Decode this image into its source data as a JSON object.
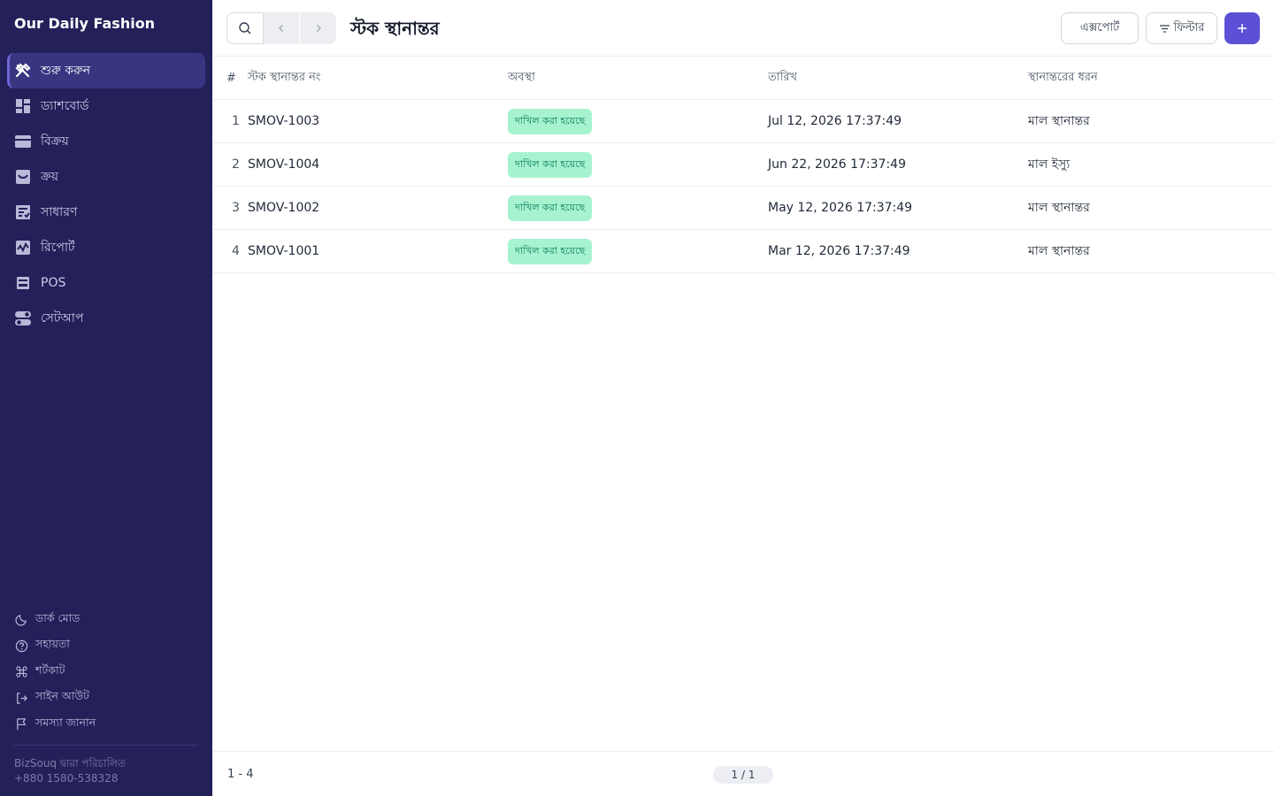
{
  "app": {
    "brand": "Our Daily Fashion"
  },
  "sidebar": {
    "items": [
      {
        "label": "শুরু করুন",
        "icon": "tools-icon",
        "active": true
      },
      {
        "label": "ড্যাশবোর্ড",
        "icon": "dashboard-icon"
      },
      {
        "label": "বিক্রয়",
        "icon": "card-icon"
      },
      {
        "label": "ক্রয়",
        "icon": "inbox-icon"
      },
      {
        "label": "সাধারণ",
        "icon": "ledger-icon"
      },
      {
        "label": "রিপোর্ট",
        "icon": "chart-icon"
      },
      {
        "label": "POS",
        "icon": "pos-icon"
      },
      {
        "label": "সেটআপ",
        "icon": "toggle-icon"
      }
    ],
    "bottom": [
      {
        "label": "ডার্ক মোড",
        "icon": "moon-icon"
      },
      {
        "label": "সহায়তা",
        "icon": "help-icon"
      },
      {
        "label": "শর্টকাট",
        "icon": "command-icon"
      },
      {
        "label": "সাইন আউট",
        "icon": "logout-icon"
      },
      {
        "label": "সমস্যা জানান",
        "icon": "flag-icon"
      }
    ],
    "powered_by": "BizSouq দ্বারা পরিচালিত",
    "phone": "+880 1580-538328"
  },
  "header": {
    "title": "স্টক স্থানান্তর",
    "export_label": "এক্সপোর্ট",
    "filter_label": "ফিল্টার"
  },
  "table": {
    "columns": [
      "#",
      "স্টক স্থানান্তর নং",
      "অবস্থা",
      "তারিখ",
      "স্থানান্তরের ধরন"
    ],
    "rows": [
      {
        "idx": "1",
        "no": "SMOV-1003",
        "status": "দাখিল করা হয়েছে",
        "date": "Jul 12, 2026 17:37:49",
        "type": "মাল স্থানান্তর"
      },
      {
        "idx": "2",
        "no": "SMOV-1004",
        "status": "দাখিল করা হয়েছে",
        "date": "Jun 22, 2026 17:37:49",
        "type": "মাল ইস্যু"
      },
      {
        "idx": "3",
        "no": "SMOV-1002",
        "status": "দাখিল করা হয়েছে",
        "date": "May 12, 2026 17:37:49",
        "type": "মাল স্থানান্তর"
      },
      {
        "idx": "4",
        "no": "SMOV-1001",
        "status": "দাখিল করা হয়েছে",
        "date": "Mar 12, 2026 17:37:49",
        "type": "মাল স্থানান্তর"
      }
    ]
  },
  "footer": {
    "range": "1 - 4",
    "page": "1 / 1"
  },
  "colors": {
    "sidebar_bg": "#23205a",
    "accent": "#5b50d6",
    "badge_bg": "#a7f3d0",
    "badge_text": "#047857"
  }
}
